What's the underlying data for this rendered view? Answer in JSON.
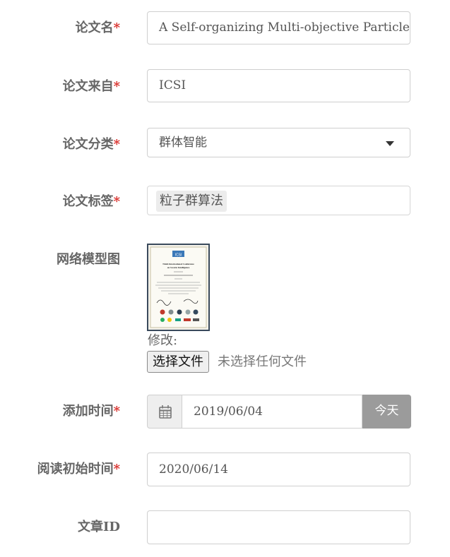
{
  "form": {
    "paper_name": {
      "label": "论文名",
      "required_mark": "*",
      "value": "A Self-organizing Multi-objective Particle"
    },
    "paper_source": {
      "label": "论文来自",
      "required_mark": "*",
      "value": "ICSI"
    },
    "paper_category": {
      "label": "论文分类",
      "required_mark": "*",
      "selected": "群体智能"
    },
    "paper_tags": {
      "label": "论文标签",
      "required_mark": "*",
      "tags": [
        "粒子群算法"
      ]
    },
    "network_image": {
      "label": "网络模型图",
      "thumbnail": {
        "logo_text": "ICSI",
        "title_line1": "Ninth International Conference",
        "title_line2": "on Swarm Intelligence"
      },
      "modify_label": "修改:",
      "choose_file_button": "选择文件",
      "no_file_text": "未选择任何文件"
    },
    "added_time": {
      "label": "添加时间",
      "required_mark": "*",
      "icon": "calendar-icon",
      "value": "2019/06/04",
      "today_button": "今天"
    },
    "read_start_time": {
      "label": "阅读初始时间",
      "required_mark": "*",
      "value": "2020/06/14"
    },
    "article_id": {
      "label": "文章ID",
      "value": ""
    }
  },
  "colors": {
    "required": "#d9302c",
    "label": "#666666",
    "border": "#cfcfcf",
    "addon_bg": "#eeeeee",
    "today_button_bg": "#9b9b9b",
    "tag_bg": "#ececec"
  }
}
